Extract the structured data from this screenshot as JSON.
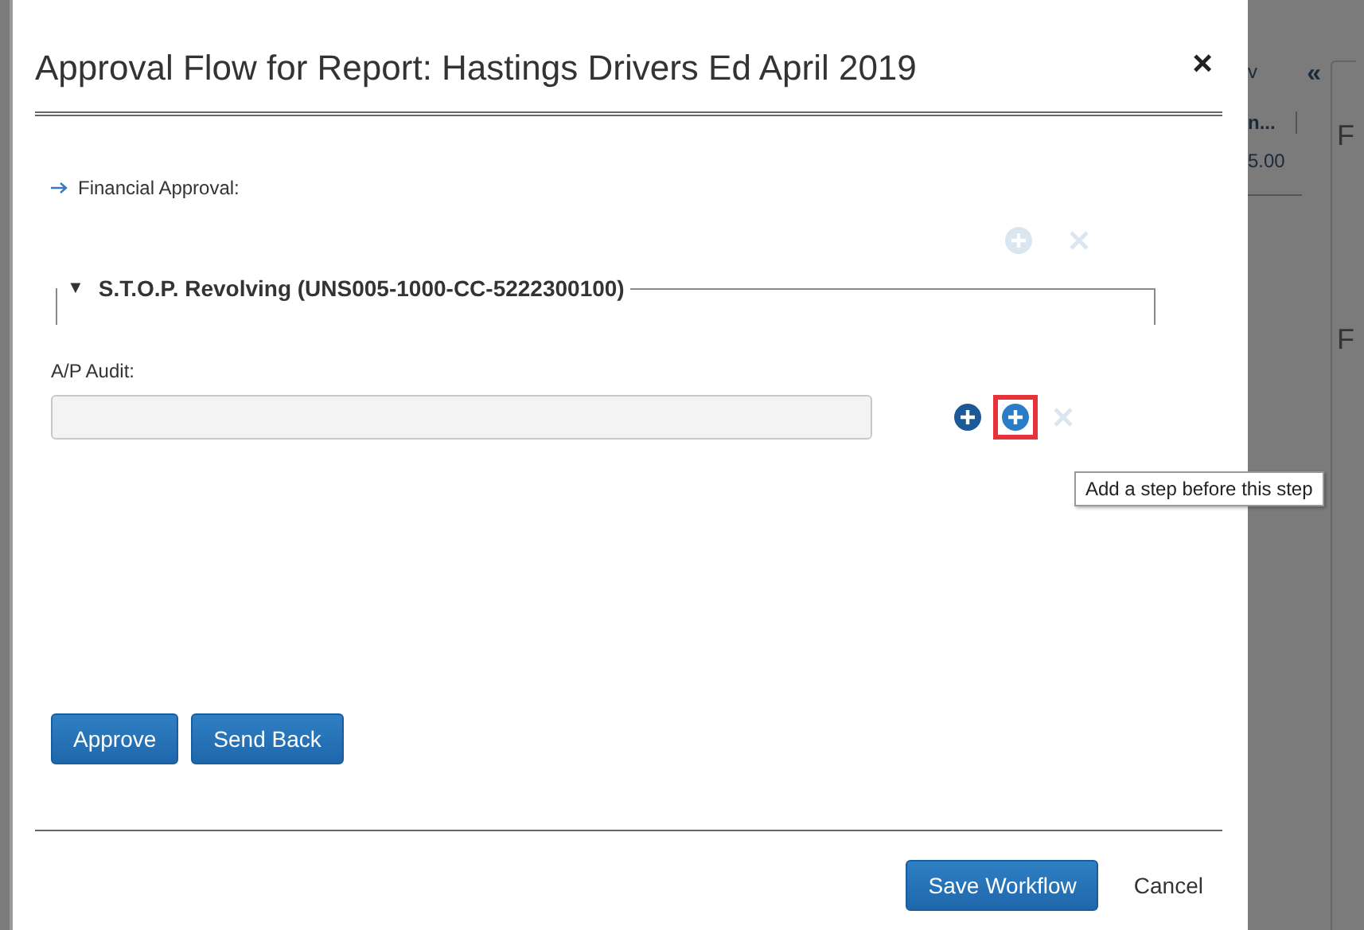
{
  "background": {
    "menu_label": "v",
    "collapse": "«",
    "column_header": "n...",
    "cell": "5.00",
    "panel_letters": [
      "F",
      "F"
    ]
  },
  "dialog": {
    "title": "Approval Flow for Report: Hastings Drivers Ed April 2019",
    "close": "×",
    "stage": {
      "label": "Financial Approval:"
    },
    "group_actions": [
      {
        "kind": "add",
        "disabled": true,
        "highlighted": false
      },
      {
        "kind": "remove",
        "disabled": true,
        "highlighted": false
      }
    ],
    "group": {
      "toggle": "▼",
      "title": "S.T.O.P. Revolving (UNS005-1000-CC-5222300100)"
    },
    "step": {
      "label": "A/P Audit:"
    },
    "step_actions": [
      {
        "kind": "add",
        "disabled": false,
        "highlighted": false
      },
      {
        "kind": "add",
        "disabled": false,
        "highlighted": true
      },
      {
        "kind": "remove",
        "disabled": true,
        "highlighted": false
      }
    ],
    "tooltip": "Add a step before this step",
    "actions": [
      "Approve",
      "Send Back"
    ],
    "footer": {
      "primary": "Save Workflow",
      "secondary": "Cancel"
    }
  }
}
